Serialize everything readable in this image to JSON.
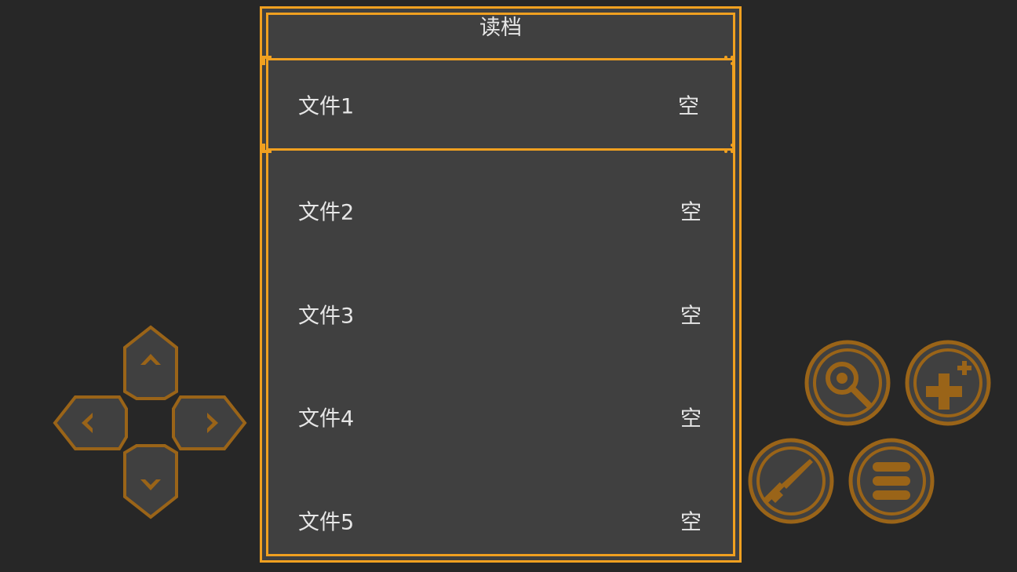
{
  "dialog": {
    "title": "读档",
    "slots": [
      {
        "name": "文件1",
        "status": "空",
        "selected": true
      },
      {
        "name": "文件2",
        "status": "空",
        "selected": false
      },
      {
        "name": "文件3",
        "status": "空",
        "selected": false
      },
      {
        "name": "文件4",
        "status": "空",
        "selected": false
      },
      {
        "name": "文件5",
        "status": "空",
        "selected": false
      }
    ]
  },
  "controls": {
    "dpad": [
      "dpad-up-icon",
      "dpad-left-icon",
      "dpad-right-icon",
      "dpad-down-icon"
    ],
    "actions": [
      "search-icon",
      "add-plus-icon",
      "sword-icon",
      "menu-icon"
    ]
  },
  "colors": {
    "accent": "#f0a020",
    "control": "#9a6418",
    "panel": "#404040",
    "background": "#272727",
    "text": "#e6e6e6"
  }
}
